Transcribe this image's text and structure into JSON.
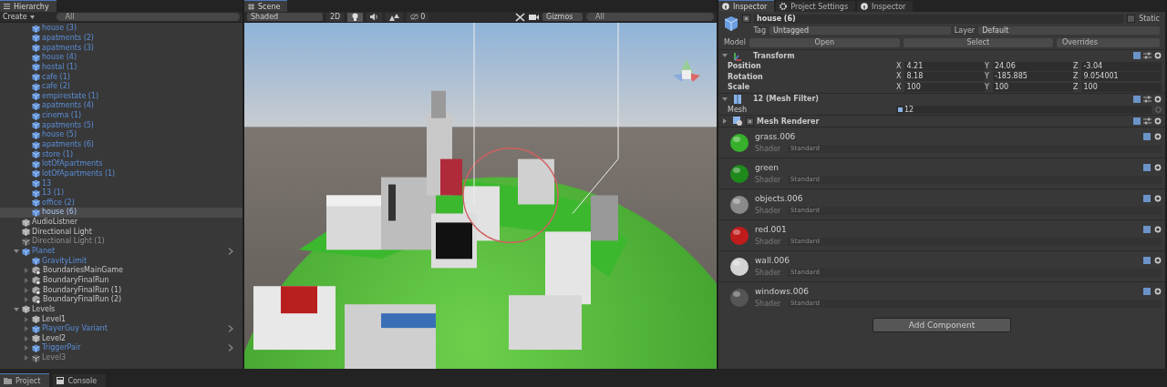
{
  "hierarchy": {
    "tab": "Hierarchy",
    "create": "Create",
    "search_placeholder": "All",
    "scrolled_items": [
      {
        "name": "house (3)",
        "kind": "prefab",
        "active": true,
        "selected": false,
        "override_arrow": false
      },
      {
        "name": "apatments (2)",
        "kind": "prefab",
        "active": true,
        "selected": false,
        "override_arrow": false
      },
      {
        "name": "apatments (3)",
        "kind": "prefab",
        "active": true,
        "selected": false,
        "override_arrow": false
      },
      {
        "name": "house (4)",
        "kind": "prefab",
        "active": true,
        "selected": false,
        "override_arrow": false
      },
      {
        "name": "hostal (1)",
        "kind": "prefab",
        "active": true,
        "selected": false,
        "override_arrow": false
      },
      {
        "name": "cafe (1)",
        "kind": "prefab",
        "active": true,
        "selected": false,
        "override_arrow": false
      },
      {
        "name": "cafe (2)",
        "kind": "prefab",
        "active": true,
        "selected": false,
        "override_arrow": false
      },
      {
        "name": "empirestate (1)",
        "kind": "prefab",
        "active": true,
        "selected": false,
        "override_arrow": false
      },
      {
        "name": "apatments (4)",
        "kind": "prefab",
        "active": true,
        "selected": false,
        "override_arrow": false
      },
      {
        "name": "cinema (1)",
        "kind": "prefab",
        "active": true,
        "selected": false,
        "override_arrow": false
      },
      {
        "name": "apatments (5)",
        "kind": "prefab",
        "active": true,
        "selected": false,
        "override_arrow": false
      },
      {
        "name": "house (5)",
        "kind": "prefab",
        "active": true,
        "selected": false,
        "override_arrow": false
      },
      {
        "name": "apatments (6)",
        "kind": "prefab",
        "active": true,
        "selected": false,
        "override_arrow": false
      },
      {
        "name": "store (1)",
        "kind": "prefab",
        "active": true,
        "selected": false,
        "override_arrow": false
      },
      {
        "name": "lotOfApartments",
        "kind": "prefab",
        "active": true,
        "selected": false,
        "override_arrow": false
      },
      {
        "name": "lotOfApartments (1)",
        "kind": "prefab",
        "active": true,
        "selected": false,
        "override_arrow": false
      },
      {
        "name": "13",
        "kind": "prefab",
        "active": true,
        "selected": false,
        "override_arrow": false
      },
      {
        "name": "13 (1)",
        "kind": "prefab",
        "active": true,
        "selected": false,
        "override_arrow": false
      },
      {
        "name": "office (2)",
        "kind": "prefab",
        "active": true,
        "selected": false,
        "override_arrow": false
      },
      {
        "name": "house (6)",
        "kind": "prefab",
        "active": true,
        "selected": true,
        "override_arrow": false
      }
    ],
    "items": [
      {
        "name": "AudioListner",
        "kind": "object",
        "active": true,
        "selected": false,
        "override_arrow": false
      },
      {
        "name": "Directional Light",
        "kind": "object",
        "active": true,
        "selected": false,
        "override_arrow": false
      },
      {
        "name": "Directional Light (1)",
        "kind": "object",
        "active": false,
        "selected": false,
        "override_arrow": false
      },
      {
        "name": "Planet",
        "kind": "prefab",
        "active": true,
        "selected": false,
        "override_arrow": true,
        "expanded": true,
        "children": [
          {
            "name": "GravityLimit",
            "kind": "prefab",
            "active": true,
            "selected": false,
            "override_arrow": false
          },
          {
            "name": "BoundariesMainGame",
            "kind": "scripted",
            "active": true,
            "selected": false,
            "override_arrow": false,
            "expanded": false
          },
          {
            "name": "BoundaryFinalRun",
            "kind": "scripted",
            "active": true,
            "selected": false,
            "override_arrow": false,
            "expanded": false
          },
          {
            "name": "BoundaryFinalRun (1)",
            "kind": "scripted",
            "active": true,
            "selected": false,
            "override_arrow": false,
            "expanded": false
          },
          {
            "name": "BoundaryFinalRun (2)",
            "kind": "scripted",
            "active": true,
            "selected": false,
            "override_arrow": false,
            "expanded": false
          }
        ]
      },
      {
        "name": "Levels",
        "kind": "object",
        "active": true,
        "selected": false,
        "override_arrow": false,
        "expanded": true,
        "children": [
          {
            "name": "Level1",
            "kind": "object",
            "active": true,
            "selected": false,
            "override_arrow": false,
            "expanded": false
          },
          {
            "name": "PlayerGuy Variant",
            "kind": "prefab",
            "active": true,
            "selected": false,
            "override_arrow": true,
            "expanded": false
          },
          {
            "name": "Level2",
            "kind": "object",
            "active": true,
            "selected": false,
            "override_arrow": false,
            "expanded": false
          },
          {
            "name": "TriggerPair",
            "kind": "prefab",
            "active": true,
            "selected": false,
            "override_arrow": true,
            "expanded": false
          },
          {
            "name": "Level3",
            "kind": "object",
            "active": false,
            "selected": false,
            "override_arrow": false,
            "expanded": false
          }
        ]
      }
    ]
  },
  "bottom_tabs": [
    {
      "label": "Project",
      "kind": "project",
      "selected": true
    },
    {
      "label": "Console",
      "kind": "console",
      "selected": false
    }
  ],
  "scene": {
    "tab": "Scene",
    "shading": "Shaded",
    "mode_2d": "2D",
    "toggles": [
      {
        "kind": "lighting",
        "on": true
      },
      {
        "kind": "audio",
        "on": false
      },
      {
        "kind": "effects",
        "on": false
      }
    ],
    "hidden_count": "0",
    "gizmos": "Gizmos",
    "search_placeholder": "All"
  },
  "inspector": {
    "tabs": [
      {
        "label": "Inspector",
        "kind": "info",
        "selected": true
      },
      {
        "label": "Project Settings",
        "kind": "settings",
        "selected": false
      },
      {
        "label": "Inspector",
        "kind": "info",
        "selected": false
      }
    ],
    "object": {
      "active": true,
      "name": "house (6)",
      "static": false,
      "static_label": "Static",
      "tag_label": "Tag",
      "tag": "Untagged",
      "layer_label": "Layer",
      "layer": "Default",
      "model_label": "Model",
      "model_buttons": [
        "Open",
        "Select",
        "Overrides"
      ]
    },
    "components": [
      {
        "kind": "transform",
        "title": "Transform",
        "expanded": true,
        "rows": [
          {
            "label": "Position",
            "values": [
              {
                "axis": "X",
                "value": "4.21"
              },
              {
                "axis": "Y",
                "value": "24.06"
              },
              {
                "axis": "Z",
                "value": "-3.04"
              }
            ]
          },
          {
            "label": "Rotation",
            "values": [
              {
                "axis": "X",
                "value": "8.18"
              },
              {
                "axis": "Y",
                "value": "-185.885"
              },
              {
                "axis": "Z",
                "value": "9.054001"
              }
            ]
          },
          {
            "label": "Scale",
            "values": [
              {
                "axis": "X",
                "value": "100"
              },
              {
                "axis": "Y",
                "value": "100"
              },
              {
                "axis": "Z",
                "value": "100"
              }
            ]
          }
        ]
      },
      {
        "kind": "mesh_filter",
        "title": "12 (Mesh Filter)",
        "expanded": true,
        "fields": [
          {
            "label": "Mesh",
            "value": "12"
          }
        ]
      },
      {
        "kind": "mesh_renderer",
        "title": "Mesh Renderer",
        "enabled": true,
        "expanded": false
      }
    ],
    "materials": [
      {
        "name": "grass.006",
        "color": "#38b02c",
        "shader_label": "Shader",
        "shader": "Standard"
      },
      {
        "name": "green",
        "color": "#1f8a1c",
        "shader_label": "Shader",
        "shader": "Standard"
      },
      {
        "name": "objects.006",
        "color": "#8a8a8a",
        "shader_label": "Shader",
        "shader": "Standard"
      },
      {
        "name": "red.001",
        "color": "#c01c1c",
        "shader_label": "Shader",
        "shader": "Standard"
      },
      {
        "name": "wall.006",
        "color": "#d4d4d4",
        "shader_label": "Shader",
        "shader": "Standard"
      },
      {
        "name": "windows.006",
        "color": "#555555",
        "shader_label": "Shader",
        "shader": "Standard"
      }
    ],
    "add_component": "Add Component"
  }
}
